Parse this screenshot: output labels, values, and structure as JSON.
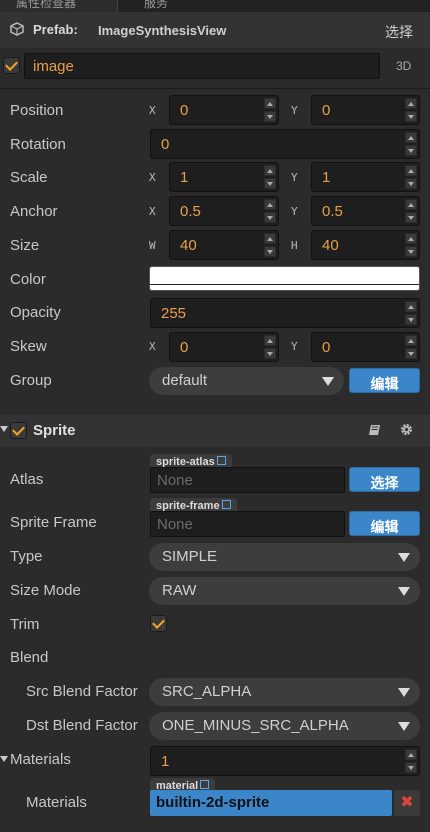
{
  "tabs": [
    "属性检查器",
    "服务"
  ],
  "prefab": {
    "label": "Prefab:",
    "name": "ImageSynthesisView",
    "select": "选择"
  },
  "node": {
    "name": "image",
    "mode": "3D"
  },
  "position": {
    "label": "Position",
    "x_axis": "X",
    "y_axis": "Y",
    "x": "0",
    "y": "0"
  },
  "rotation": {
    "label": "Rotation",
    "value": "0"
  },
  "scale": {
    "label": "Scale",
    "x_axis": "X",
    "y_axis": "Y",
    "x": "1",
    "y": "1"
  },
  "anchor": {
    "label": "Anchor",
    "x_axis": "X",
    "y_axis": "Y",
    "x": "0.5",
    "y": "0.5"
  },
  "size": {
    "label": "Size",
    "w_axis": "W",
    "h_axis": "H",
    "w": "40",
    "h": "40"
  },
  "color": {
    "label": "Color",
    "value": "#ffffff"
  },
  "opacity": {
    "label": "Opacity",
    "value": "255"
  },
  "skew": {
    "label": "Skew",
    "x_axis": "X",
    "y_axis": "Y",
    "x": "0",
    "y": "0"
  },
  "group": {
    "label": "Group",
    "value": "default",
    "edit": "编辑"
  },
  "sprite": {
    "title": "Sprite",
    "atlas": {
      "label": "Atlas",
      "tag": "sprite-atlas",
      "value": "None",
      "button": "选择"
    },
    "frame": {
      "label": "Sprite Frame",
      "tag": "sprite-frame",
      "value": "None",
      "button": "编辑"
    },
    "type": {
      "label": "Type",
      "value": "SIMPLE"
    },
    "size_mode": {
      "label": "Size Mode",
      "value": "RAW"
    },
    "trim": {
      "label": "Trim"
    },
    "blend": {
      "label": "Blend"
    },
    "src_blend": {
      "label": "Src Blend Factor",
      "value": "SRC_ALPHA"
    },
    "dst_blend": {
      "label": "Dst Blend Factor",
      "value": "ONE_MINUS_SRC_ALPHA"
    },
    "materials": {
      "label": "Materials",
      "count": "1",
      "item_label": "Materials",
      "tag": "material",
      "value": "builtin-2d-sprite"
    }
  }
}
